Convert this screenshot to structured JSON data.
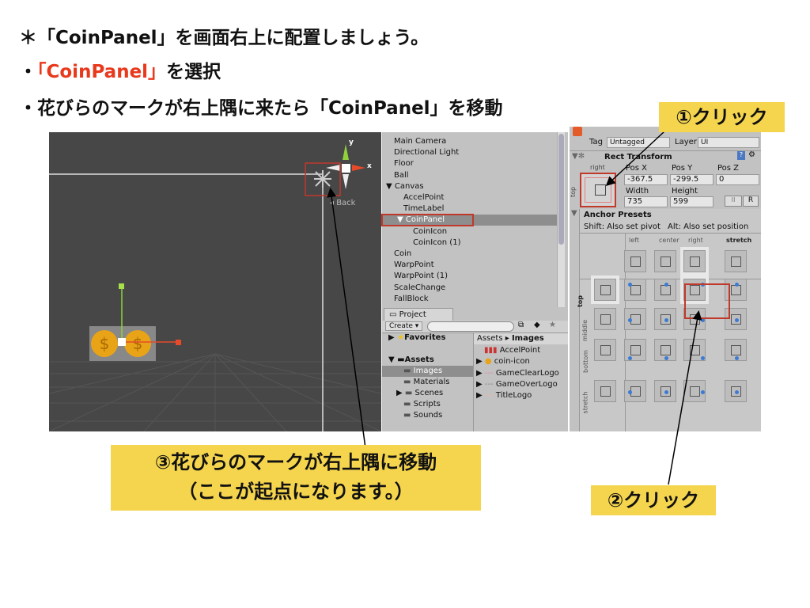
{
  "slide": {
    "line1": "＊「CoinPanel」を画面右上に配置しましょう。",
    "line2_bullet": "・",
    "line2_highlight": "「CoinPanel」",
    "line2_rest": "を選択",
    "line3": "・花びらのマークが右上隅に来たら「CoinPanel」を移動"
  },
  "notes": {
    "click1": "①クリック",
    "click2": "②クリック",
    "move3_line1": "③花びらのマークが右上隅に移動",
    "move3_line2": "（ここが起点になります。）"
  },
  "scene": {
    "axis_y": "y",
    "axis_x": "x",
    "back_label": "◂ Back"
  },
  "hierarchy": {
    "items": [
      {
        "label": "Main Camera",
        "indent": 0
      },
      {
        "label": "Directional Light",
        "indent": 0
      },
      {
        "label": "Floor",
        "indent": 0
      },
      {
        "label": "Ball",
        "indent": 0
      },
      {
        "label": "▼ Canvas",
        "indent": 0
      },
      {
        "label": "AccelPoint",
        "indent": 1
      },
      {
        "label": "TimeLabel",
        "indent": 1
      },
      {
        "label": "▼ CoinPanel",
        "indent": 1,
        "selected": true
      },
      {
        "label": "CoinIcon",
        "indent": 2
      },
      {
        "label": "CoinIcon (1)",
        "indent": 2
      },
      {
        "label": "Coin",
        "indent": 0
      },
      {
        "label": "WarpPoint",
        "indent": 0
      },
      {
        "label": "WarpPoint (1)",
        "indent": 0
      },
      {
        "label": "ScaleChange",
        "indent": 0
      },
      {
        "label": "FallBlock",
        "indent": 0
      }
    ]
  },
  "project": {
    "tab": "Project",
    "create": "Create ▾",
    "search_placeholder": "",
    "favorites": "Favorites",
    "assets": "Assets",
    "folders": [
      "Images",
      "Materials",
      "Scenes",
      "Scripts",
      "Sounds"
    ],
    "breadcrumb_root": "Assets",
    "breadcrumb_current": "Images",
    "files": [
      "AccelPoint",
      "coin-icon",
      "GameClearLogo",
      "GameOverLogo",
      "TitleLogo"
    ]
  },
  "inspector": {
    "tag_label": "Tag",
    "tag_value": "Untagged",
    "layer_label": "Layer",
    "layer_value": "UI",
    "component": "Rect Transform",
    "anchor_h": "right",
    "anchor_v": "top",
    "pos_x_label": "Pos X",
    "pos_x": "-367.5",
    "pos_y_label": "Pos Y",
    "pos_y": "-299.5",
    "pos_z_label": "Pos Z",
    "pos_z": "0",
    "width_label": "Width",
    "width": "735",
    "height_label": "Height",
    "height": "599",
    "r_button": "R",
    "presets_title": "Anchor Presets",
    "presets_hint_shift": "Shift: Also set pivot",
    "presets_hint_alt": "Alt: Also set position",
    "cols": [
      "left",
      "center",
      "right",
      "stretch"
    ],
    "rows": [
      "top",
      "middle",
      "bottom",
      "stretch"
    ]
  },
  "colors": {
    "accent_red": "#e8391d",
    "note_yellow": "#f5d54e",
    "highlight_box": "#c0392b"
  }
}
